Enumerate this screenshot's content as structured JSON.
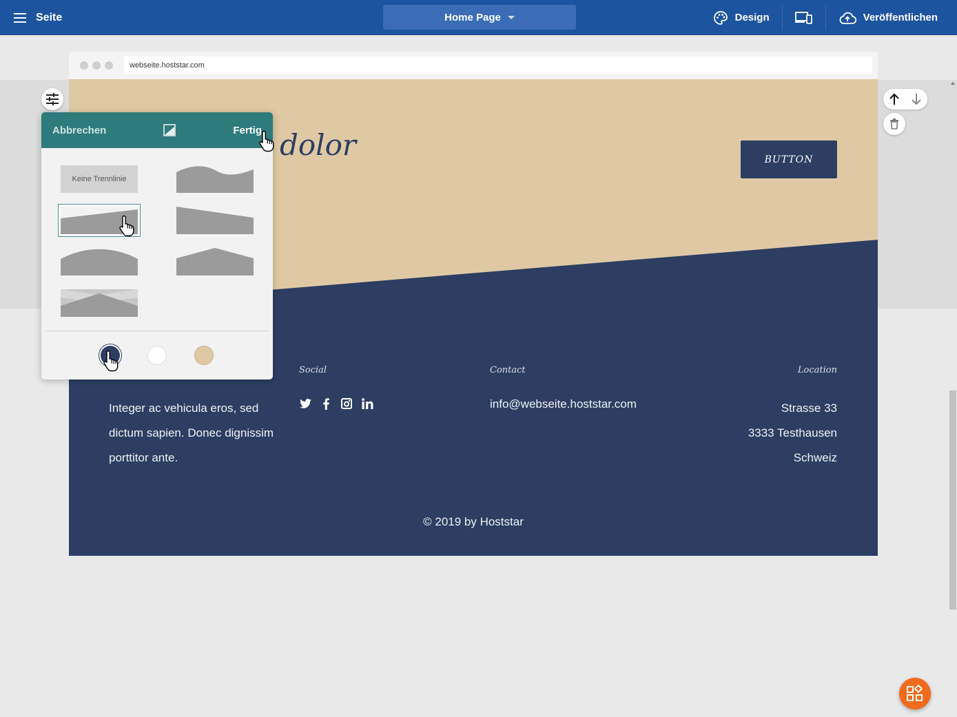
{
  "topbar": {
    "menu_label": "Seite",
    "page_select": "Home Page",
    "design_label": "Design",
    "publish_label": "Veröffentlichen"
  },
  "browser": {
    "url": "webseite.hoststar.com"
  },
  "hero": {
    "headline_fragment": "dolor",
    "button_label": "BUTTON"
  },
  "footer": {
    "about_text": "Integer ac vehicula eros, sed dictum sapien. Donec dignissim porttitor ante.",
    "social_heading": "Social",
    "social_icons": [
      "twitter-icon",
      "facebook-icon",
      "instagram-icon",
      "linkedin-icon"
    ],
    "contact_heading": "Contact",
    "contact_email": "info@webseite.hoststar.com",
    "location_heading": "Location",
    "location_lines": [
      "Strasse 33",
      "3333 Testhausen",
      "Schweiz"
    ],
    "copyright": "© 2019 by Hoststar"
  },
  "panel": {
    "cancel_label": "Abbrechen",
    "done_label": "Fertig",
    "no_divider_label": "Keine Trennlinie",
    "divider_options": [
      "none",
      "wave",
      "slant-up",
      "slant-down",
      "curve",
      "peak",
      "cross"
    ],
    "selected_option": "slant-up",
    "colors": [
      "#2d3e62",
      "#ffffff",
      "#dfc9a4"
    ],
    "selected_color": "#2d3e62"
  },
  "colors": {
    "topbar": "#1c54a0",
    "panel_header": "#2e7b7c",
    "hero_bg": "#dfc9a4",
    "footer_bg": "#2d3e62",
    "fab": "#f26a1b"
  }
}
